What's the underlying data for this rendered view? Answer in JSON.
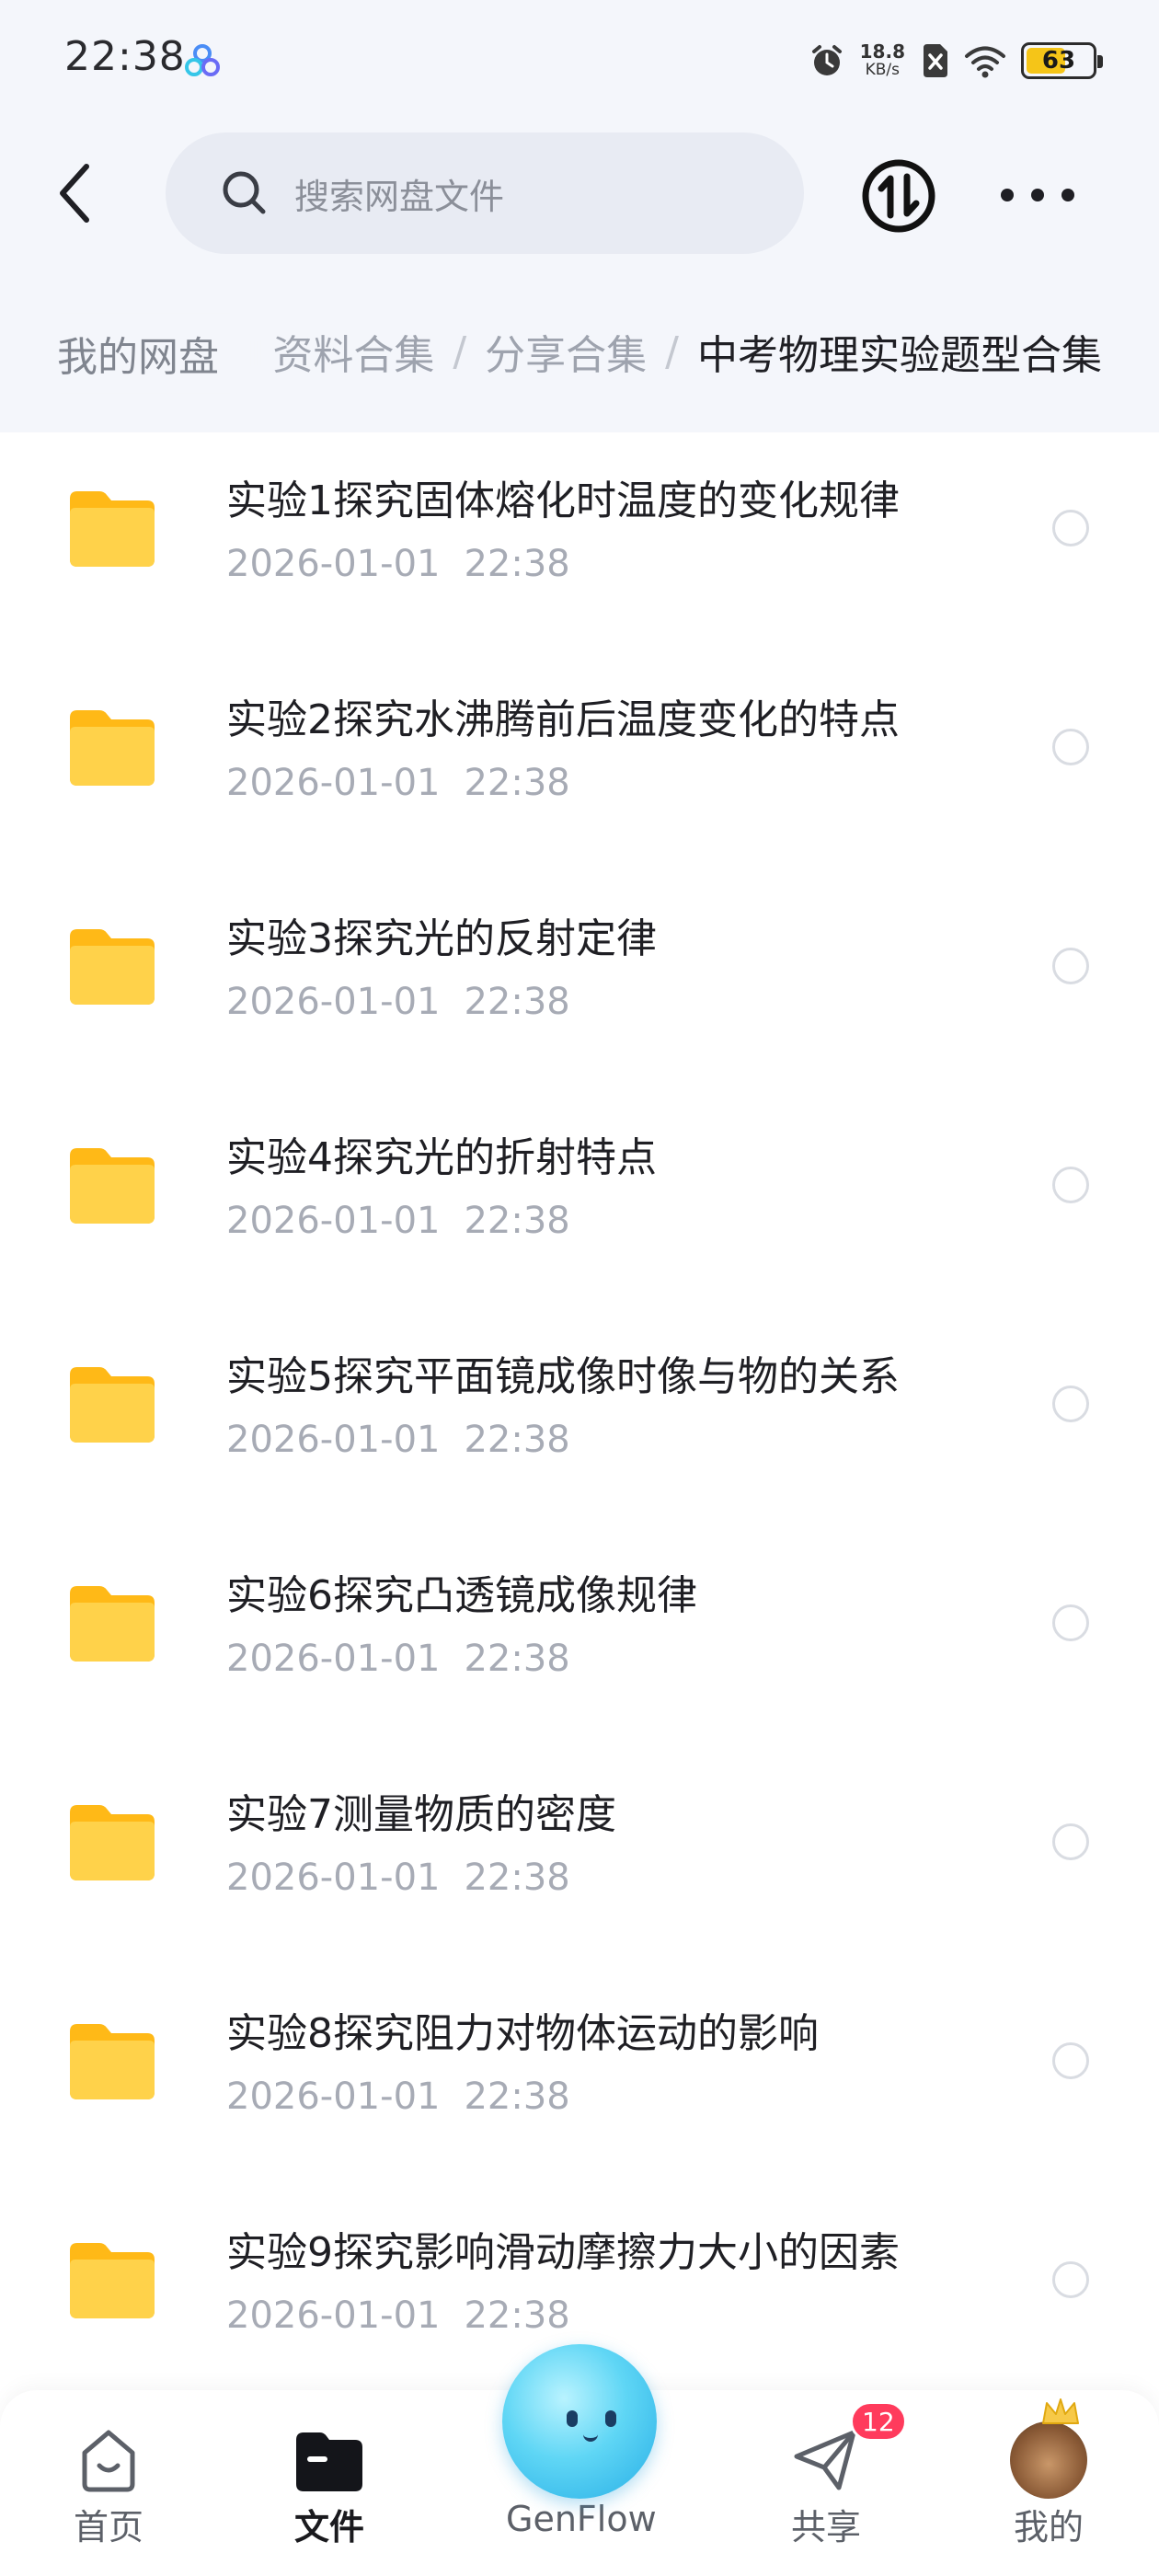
{
  "status_bar": {
    "time": "22:38",
    "net_speed_value": "18.8",
    "net_speed_unit": "KB/s",
    "battery": "63",
    "battery_level": 0.63,
    "icons": [
      "baidu-netdisk-icon",
      "alarm-icon",
      "no-sim-icon",
      "wifi-icon",
      "battery-icon"
    ]
  },
  "header": {
    "search_placeholder": "搜索网盘文件",
    "icons": [
      "back-icon",
      "search-icon",
      "transfer-icon",
      "more-icon"
    ]
  },
  "breadcrumb": {
    "root": "我的网盘",
    "items": [
      "资料合集",
      "分享合集"
    ],
    "current": "中考物理实验题型合集",
    "separator": "/"
  },
  "files": [
    {
      "name": "实验1探究固体熔化时温度的变化规律",
      "date": "2026-01-01",
      "time": "22:38"
    },
    {
      "name": "实验2探究水沸腾前后温度变化的特点",
      "date": "2026-01-01",
      "time": "22:38"
    },
    {
      "name": "实验3探究光的反射定律",
      "date": "2026-01-01",
      "time": "22:38"
    },
    {
      "name": "实验4探究光的折射特点",
      "date": "2026-01-01",
      "time": "22:38"
    },
    {
      "name": "实验5探究平面镜成像时像与物的关系",
      "date": "2026-01-01",
      "time": "22:38"
    },
    {
      "name": "实验6探究凸透镜成像规律",
      "date": "2026-01-01",
      "time": "22:38"
    },
    {
      "name": "实验7测量物质的密度",
      "date": "2026-01-01",
      "time": "22:38"
    },
    {
      "name": "实验8探究阻力对物体运动的影响",
      "date": "2026-01-01",
      "time": "22:38"
    },
    {
      "name": "实验9探究影响滑动摩擦力大小的因素",
      "date": "2026-01-01",
      "time": "22:38"
    }
  ],
  "bottom_nav": {
    "home": "首页",
    "files": "文件",
    "genflow": "GenFlow",
    "share": "共享",
    "share_badge": "12",
    "me": "我的",
    "active": "files"
  },
  "colors": {
    "folder": "#ffc93c",
    "badge": "#ff3b5c",
    "search_bg": "#e8ebf3",
    "battery_fill": "#f5c518"
  }
}
